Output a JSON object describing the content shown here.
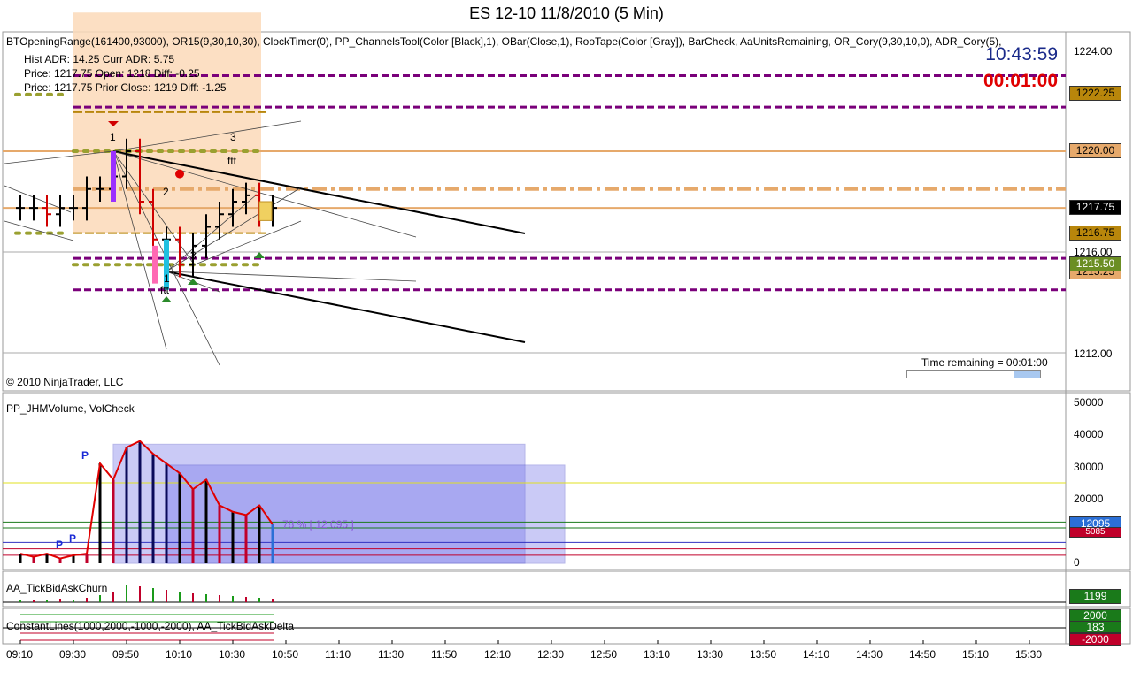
{
  "window": {
    "title": "ES 12-10  11/8/2010 (5 Min)"
  },
  "price_panel": {
    "indicator_line": "BTOpeningRange(161400,93000),  OR15(9,30,10,30),  ClockTimer(0),  PP_ChannelsTool(Color [Black],1),  OBar(Close,1),  RooTape(Color [Gray]),  BarCheck,  AaUnitsRemaining,  OR_Cory(9,30,10,0),  ADR_Cory(5),",
    "info_line1": "Hist ADR: 14.25    Curr ADR: 5.75",
    "info_line2": "Price: 1217.75    Open: 1218     Diff: -0.25",
    "info_line3": "Price: 1217.75     Prior Close: 1219    Diff: -1.25",
    "clock_time": "10:43:59",
    "countdown": "00:01:00",
    "copyright": "© 2010 NinjaTrader, LLC",
    "time_remaining": "Time remaining = 00:01:00",
    "price_axis": [
      "1224.00",
      "1220.00",
      "1216.00",
      "1212.00"
    ],
    "price_badges": [
      {
        "value": "1222.25",
        "color": "#b8860b"
      },
      {
        "value": "1220.00",
        "color": "#e6a96b"
      },
      {
        "value": "1217.75",
        "color": "#000000"
      },
      {
        "value": "1216.75",
        "color": "#b8860b"
      },
      {
        "value": "1215.50",
        "color": "#6b8e23"
      },
      {
        "value": "1215.25",
        "color": "#e6a96b"
      }
    ],
    "wave_labels": [
      "1",
      "2",
      "3",
      "ftt",
      "1",
      "ftt",
      "3"
    ]
  },
  "volume_panel": {
    "label": "PP_JHMVolume, VolCheck",
    "pct_label": "78 % [ 12 095 ]",
    "axis": [
      "50000",
      "40000",
      "30000",
      "20000",
      "10000",
      "0"
    ],
    "badge_last": "12095",
    "badge_sub": "5085",
    "p_labels": [
      "P",
      "P",
      "P"
    ]
  },
  "churn_panel": {
    "label": "AA_TickBidAskChurn",
    "badge": "1199"
  },
  "delta_panel": {
    "label": "ConstantLines(1000,2000,-1000,-2000),  AA_TickBidAskDelta",
    "badges": [
      {
        "value": "2000",
        "color": "#1a7a1a"
      },
      {
        "value": "183",
        "color": "#1a7a1a"
      },
      {
        "value": "-2000",
        "color": "#c0002a"
      }
    ]
  },
  "time_axis": [
    "09:10",
    "09:30",
    "09:50",
    "10:10",
    "10:30",
    "10:50",
    "11:10",
    "11:30",
    "11:50",
    "12:10",
    "12:30",
    "12:50",
    "13:10",
    "13:30",
    "13:50",
    "14:10",
    "14:30",
    "14:50",
    "15:10",
    "15:30"
  ],
  "chart_data": {
    "type": "bar",
    "title": "ES 12-10  11/8/2010 (5 Min)",
    "xlabel": "",
    "ylabel": "",
    "ylim": [
      1211,
      1224.5
    ],
    "categories": [
      "09:10",
      "09:15",
      "09:20",
      "09:25",
      "09:30",
      "09:35",
      "09:40",
      "09:45",
      "09:50",
      "09:55",
      "10:00",
      "10:05",
      "10:10",
      "10:15",
      "10:20",
      "10:25",
      "10:30",
      "10:35",
      "10:40",
      "10:45"
    ],
    "series": [
      {
        "name": "Price",
        "values": [
          1217.75,
          1217.75,
          1217.5,
          1217.75,
          1217.75,
          1218.5,
          1218.5,
          1219,
          1220,
          1218,
          1216.5,
          1216.5,
          1215.5,
          1216.25,
          1217,
          1217.5,
          1218,
          1218.25,
          1217.5,
          1217.75
        ]
      },
      {
        "name": "Volume",
        "values": [
          3000,
          2000,
          3000,
          1500,
          2500,
          3000,
          31000,
          26000,
          36000,
          38000,
          34000,
          31000,
          28000,
          23000,
          26000,
          18000,
          16000,
          15000,
          18000,
          12095
        ]
      }
    ]
  }
}
